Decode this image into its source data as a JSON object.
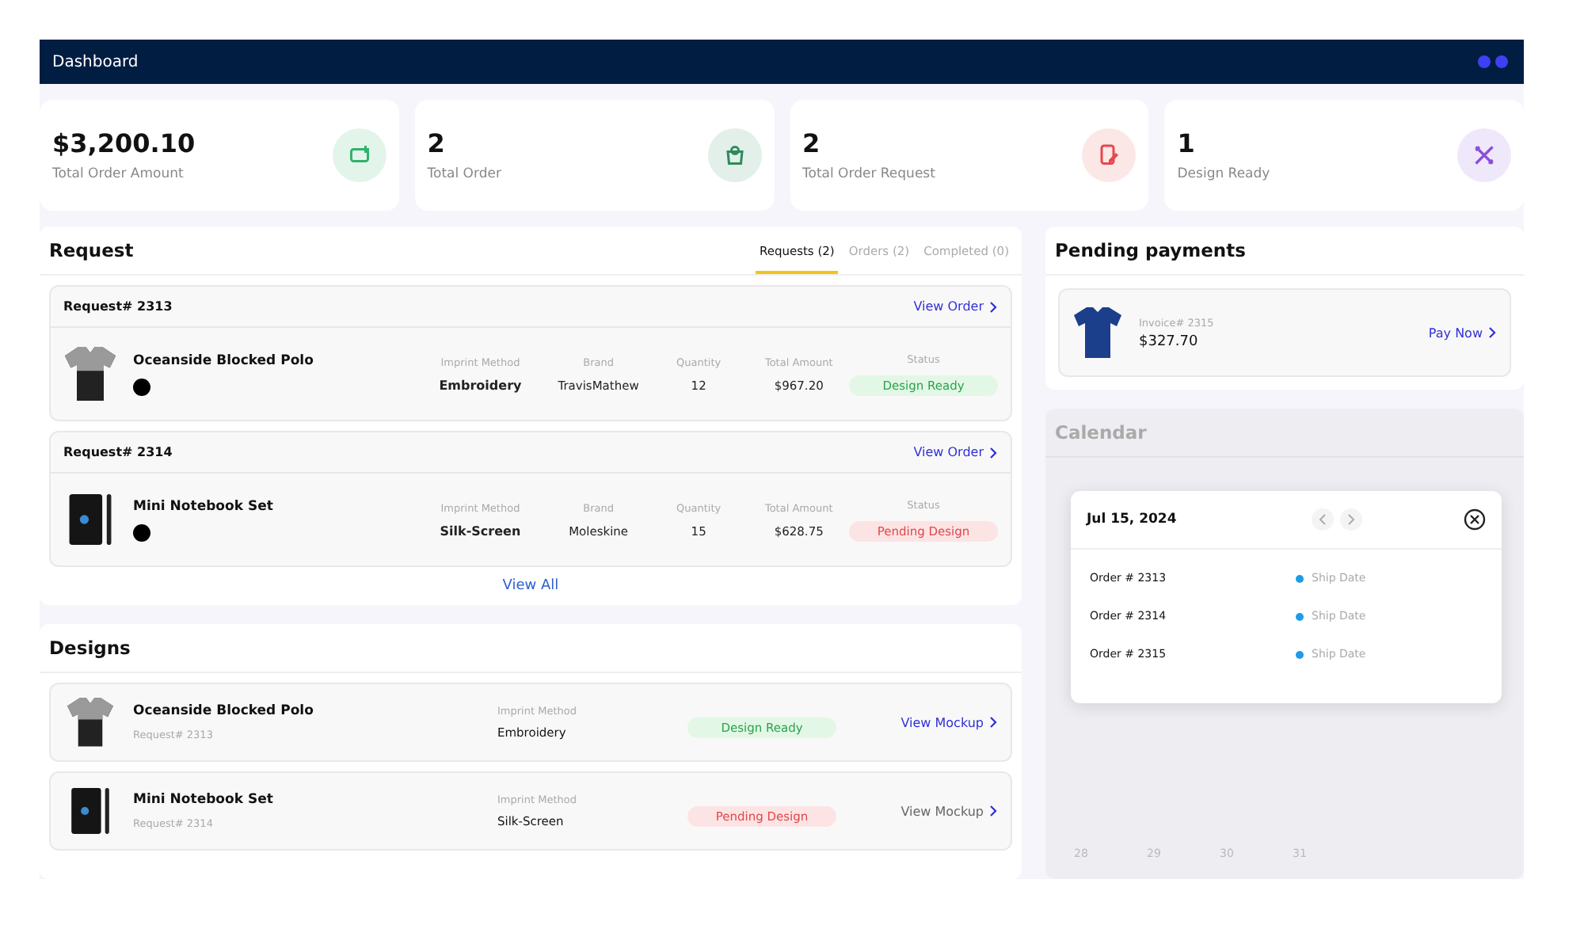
{
  "header": {
    "title": "Dashboard"
  },
  "stats": [
    {
      "value": "$3,200.10",
      "label": "Total Order Amount",
      "kind": "amount",
      "color": "#2fb36a"
    },
    {
      "value": "2",
      "label": "Total Order",
      "kind": "order",
      "color": "#2e8a5c"
    },
    {
      "value": "2",
      "label": "Total Order Request",
      "kind": "request",
      "color": "#e5484d"
    },
    {
      "value": "1",
      "label": "Design Ready",
      "kind": "design",
      "color": "#8a4fd8"
    }
  ],
  "request": {
    "title": "Request",
    "tabs": [
      {
        "label": "Requests (2)",
        "selected": true
      },
      {
        "label": "Orders (2)",
        "selected": false
      },
      {
        "label": "Completed (0)",
        "selected": false
      }
    ],
    "items": [
      {
        "number": "Request# 2313",
        "link": "View Order",
        "product": {
          "name": "Oceanside Blocked Polo",
          "kind": "polo"
        },
        "fields": [
          {
            "label": "Imprint Method",
            "value": "Embroidery"
          },
          {
            "label": "Brand",
            "value": "TravisMathew"
          },
          {
            "label": "Quantity",
            "value": "12"
          },
          {
            "label": "Total Amount",
            "value": "$967.20"
          }
        ],
        "status_label": "Status",
        "status": {
          "label": "Design Ready",
          "kind": "ready"
        }
      },
      {
        "number": "Request# 2314",
        "link": "View Order",
        "product": {
          "name": "Mini Notebook Set",
          "kind": "notebook"
        },
        "fields": [
          {
            "label": "Imprint Method",
            "value": "Silk-Screen"
          },
          {
            "label": "Brand",
            "value": "Moleskine"
          },
          {
            "label": "Quantity",
            "value": "15"
          },
          {
            "label": "Total Amount",
            "value": "$628.75"
          }
        ],
        "status_label": "Status",
        "status": {
          "label": "Pending Design",
          "kind": "pending"
        }
      }
    ],
    "view_all": "View All"
  },
  "designs": {
    "title": "Designs",
    "items": [
      {
        "product": {
          "name": "Oceanside Blocked Polo",
          "kind": "polo"
        },
        "request": "Request# 2313",
        "method_label": "Imprint Method",
        "method": "Embroidery",
        "status": {
          "label": "Design Ready",
          "kind": "ready"
        },
        "link": "View Mockup",
        "link_disabled": false
      },
      {
        "product": {
          "name": "Mini Notebook Set",
          "kind": "notebook"
        },
        "request": "Request# 2314",
        "method_label": "Imprint Method",
        "method": "Silk-Screen",
        "status": {
          "label": "Pending Design",
          "kind": "pending"
        },
        "link": "View Mockup",
        "link_disabled": true
      }
    ]
  },
  "payments": {
    "title": "Pending payments",
    "items": [
      {
        "invoice": "Invoice# 2315",
        "amount": "$327.70",
        "link": "Pay Now"
      }
    ]
  },
  "calendar": {
    "title": "Calendar",
    "last_week": [
      "28",
      "29",
      "30",
      "31"
    ],
    "popover": {
      "date": "Jul 15, 2024",
      "events": [
        {
          "order": "Order # 2313",
          "label": "Ship Date",
          "color": "#1e9be9"
        },
        {
          "order": "Order # 2314",
          "label": "Ship Date",
          "color": "#1e9be9"
        },
        {
          "order": "Order # 2315",
          "label": "Ship Date",
          "color": "#1e9be9"
        }
      ]
    }
  }
}
